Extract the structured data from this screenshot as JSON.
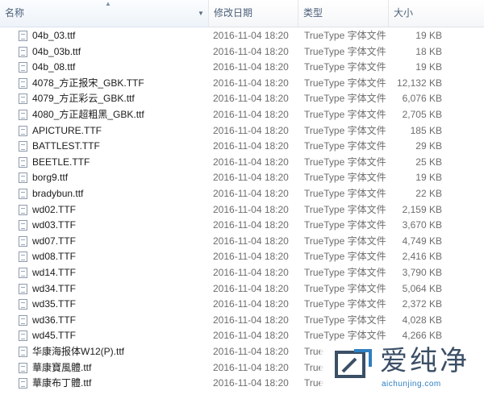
{
  "columns": {
    "name": "名称",
    "date": "修改日期",
    "type": "类型",
    "size": "大小"
  },
  "files": [
    {
      "name": "04b_03.ttf",
      "date": "2016-11-04 18:20",
      "type": "TrueType 字体文件",
      "size": "19 KB"
    },
    {
      "name": "04b_03b.ttf",
      "date": "2016-11-04 18:20",
      "type": "TrueType 字体文件",
      "size": "18 KB"
    },
    {
      "name": "04b_08.ttf",
      "date": "2016-11-04 18:20",
      "type": "TrueType 字体文件",
      "size": "19 KB"
    },
    {
      "name": "4078_方正报宋_GBK.TTF",
      "date": "2016-11-04 18:20",
      "type": "TrueType 字体文件",
      "size": "12,132 KB"
    },
    {
      "name": "4079_方正彩云_GBK.ttf",
      "date": "2016-11-04 18:20",
      "type": "TrueType 字体文件",
      "size": "6,076 KB"
    },
    {
      "name": "4080_方正超粗黑_GBK.ttf",
      "date": "2016-11-04 18:20",
      "type": "TrueType 字体文件",
      "size": "2,705 KB"
    },
    {
      "name": "APICTURE.TTF",
      "date": "2016-11-04 18:20",
      "type": "TrueType 字体文件",
      "size": "185 KB"
    },
    {
      "name": "BATTLEST.TTF",
      "date": "2016-11-04 18:20",
      "type": "TrueType 字体文件",
      "size": "29 KB"
    },
    {
      "name": "BEETLE.TTF",
      "date": "2016-11-04 18:20",
      "type": "TrueType 字体文件",
      "size": "25 KB"
    },
    {
      "name": "borg9.ttf",
      "date": "2016-11-04 18:20",
      "type": "TrueType 字体文件",
      "size": "19 KB"
    },
    {
      "name": "bradybun.ttf",
      "date": "2016-11-04 18:20",
      "type": "TrueType 字体文件",
      "size": "22 KB"
    },
    {
      "name": "wd02.TTF",
      "date": "2016-11-04 18:20",
      "type": "TrueType 字体文件",
      "size": "2,159 KB"
    },
    {
      "name": "wd03.TTF",
      "date": "2016-11-04 18:20",
      "type": "TrueType 字体文件",
      "size": "3,670 KB"
    },
    {
      "name": "wd07.TTF",
      "date": "2016-11-04 18:20",
      "type": "TrueType 字体文件",
      "size": "4,749 KB"
    },
    {
      "name": "wd08.TTF",
      "date": "2016-11-04 18:20",
      "type": "TrueType 字体文件",
      "size": "2,416 KB"
    },
    {
      "name": "wd14.TTF",
      "date": "2016-11-04 18:20",
      "type": "TrueType 字体文件",
      "size": "3,790 KB"
    },
    {
      "name": "wd34.TTF",
      "date": "2016-11-04 18:20",
      "type": "TrueType 字体文件",
      "size": "5,064 KB"
    },
    {
      "name": "wd35.TTF",
      "date": "2016-11-04 18:20",
      "type": "TrueType 字体文件",
      "size": "2,372 KB"
    },
    {
      "name": "wd36.TTF",
      "date": "2016-11-04 18:20",
      "type": "TrueType 字体文件",
      "size": "4,028 KB"
    },
    {
      "name": "wd45.TTF",
      "date": "2016-11-04 18:20",
      "type": "TrueType 字体文件",
      "size": "4,266 KB"
    },
    {
      "name": "华康海报体W12(P).ttf",
      "date": "2016-11-04 18:20",
      "type": "True",
      "size": ""
    },
    {
      "name": "華康寶風體.ttf",
      "date": "2016-11-04 18:20",
      "type": "True",
      "size": ""
    },
    {
      "name": "華康布丁體.ttf",
      "date": "2016-11-04 18:20",
      "type": "True",
      "size": ""
    }
  ],
  "watermark": {
    "title": "爱纯净",
    "url": "aichunjing.com"
  },
  "colors": {
    "header_text": "#4c607a",
    "row_text": "#1b1b1b",
    "meta_text": "#6d6d6d",
    "watermark_text": "#3b4f66",
    "watermark_url": "#2f7fc1"
  }
}
